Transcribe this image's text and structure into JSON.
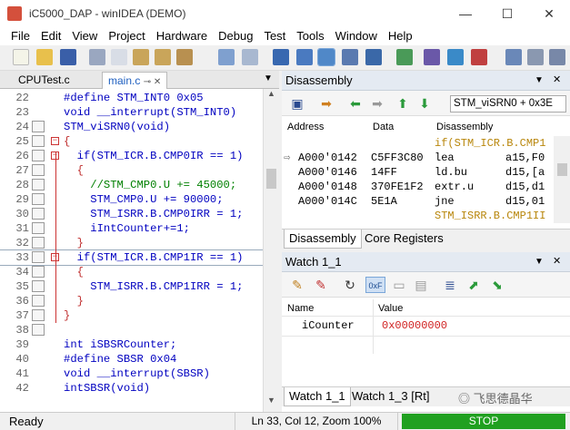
{
  "window": {
    "title": "iC5000_DAP - winIDEA (DEMO)",
    "minimize": "—",
    "maximize": "☐",
    "close": "✕"
  },
  "menu": [
    "File",
    "Edit",
    "View",
    "Project",
    "Hardware",
    "Debug",
    "Test",
    "Tools",
    "Window",
    "Help"
  ],
  "editor": {
    "tabs": [
      "CPUTest.c",
      "main.c"
    ],
    "lines": [
      {
        "n": "22",
        "text": "#define STM_INT0 0x05",
        "cls": "kw"
      },
      {
        "n": "23",
        "text": "void __interrupt(STM_INT0)",
        "cls": "kw"
      },
      {
        "n": "24",
        "text": "STM_viSRN0(void)",
        "cls": "kw"
      },
      {
        "n": "25",
        "text": "{",
        "cls": "",
        "fold": "−"
      },
      {
        "n": "26",
        "text": "  if(STM_ICR.B.CMP0IR == 1)",
        "cls": "kw",
        "fold": "−"
      },
      {
        "n": "27",
        "text": "  {",
        "cls": ""
      },
      {
        "n": "28",
        "text": "    //STM_CMP0.U += 45000;",
        "cls": "cm"
      },
      {
        "n": "29",
        "text": "    STM_CMP0.U += 90000;",
        "cls": "kw"
      },
      {
        "n": "30",
        "text": "    STM_ISRR.B.CMP0IRR = 1;",
        "cls": "kw"
      },
      {
        "n": "31",
        "text": "    iIntCounter+=1;",
        "cls": "kw"
      },
      {
        "n": "32",
        "text": "  }",
        "cls": ""
      },
      {
        "n": "33",
        "text": "  if(STM_ICR.B.CMP1IR == 1)",
        "cls": "kw",
        "fold": "−",
        "current": true
      },
      {
        "n": "34",
        "text": "  {",
        "cls": ""
      },
      {
        "n": "35",
        "text": "    STM_ISRR.B.CMP1IRR = 1;",
        "cls": "kw"
      },
      {
        "n": "36",
        "text": "  }",
        "cls": ""
      },
      {
        "n": "37",
        "text": "}",
        "cls": ""
      },
      {
        "n": "38",
        "text": "",
        "cls": ""
      },
      {
        "n": "39",
        "text": "int iSBSRCounter;",
        "cls": "kw"
      },
      {
        "n": "40",
        "text": "#define SBSR 0x04",
        "cls": "kw"
      },
      {
        "n": "41",
        "text": "void __interrupt(SBSR)",
        "cls": "kw"
      },
      {
        "n": "42",
        "text": "intSBSR(void)",
        "cls": "kw"
      }
    ]
  },
  "disassembly": {
    "title": "Disassembly",
    "location": "STM_viSRN0 + 0x3E",
    "columns": [
      "Address",
      "Data",
      "Disassembly"
    ],
    "rows": [
      {
        "addr": "",
        "data": "",
        "asm": "if(STM_ICR.B.CMP1",
        "src": true
      },
      {
        "addr": "A000'0142",
        "data": "C5FF3C80",
        "asm": "lea",
        "ops": "a15,F0",
        "cur": true
      },
      {
        "addr": "A000'0146",
        "data": "14FF",
        "asm": "ld.bu",
        "ops": "d15,[a"
      },
      {
        "addr": "A000'0148",
        "data": "370FE1F2",
        "asm": "extr.u",
        "ops": "d15,d1"
      },
      {
        "addr": "A000'014C",
        "data": "5E1A",
        "asm": "jne",
        "ops": "d15,01"
      },
      {
        "addr": "",
        "data": "",
        "asm": "STM_ISRR.B.CMP1II",
        "src": true
      }
    ],
    "tabs": [
      "Disassembly",
      "Core Registers"
    ]
  },
  "watch": {
    "title": "Watch 1_1",
    "columns": [
      "Name",
      "Value"
    ],
    "rows": [
      {
        "name": "iCounter",
        "value": "0x00000000"
      }
    ],
    "tabs": [
      "Watch 1_1",
      "Watch 1_3 [Rt]"
    ],
    "watermark": "飞思德晶华"
  },
  "status": {
    "ready": "Ready",
    "position": "Ln 33, Col 12, Zoom 100%",
    "state": "STOP",
    "state_color": "#20a020"
  }
}
